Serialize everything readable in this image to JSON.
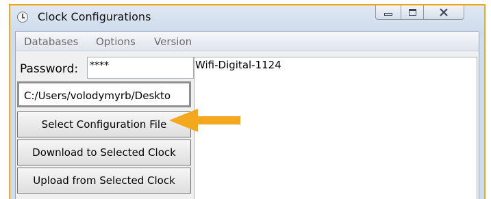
{
  "window": {
    "title": "Clock Configurations",
    "controls": {
      "minimize": "minimize-icon",
      "maximize": "maximize-icon",
      "close": "close-icon"
    }
  },
  "menu": {
    "items": [
      "Databases",
      "Options",
      "Version"
    ]
  },
  "password": {
    "label": "Password:",
    "value": "****"
  },
  "path_field": {
    "value": "C:/Users/volodymyrb/Deskto"
  },
  "buttons": [
    {
      "label": "Select Configuration File"
    },
    {
      "label": "Download to Selected Clock"
    },
    {
      "label": "Upload from Selected Clock"
    }
  ],
  "output": {
    "text": "Wifi-Digital-1124"
  },
  "annotation": {
    "arrow_color": "#f4a81d",
    "frame_color": "#f4a81d"
  }
}
